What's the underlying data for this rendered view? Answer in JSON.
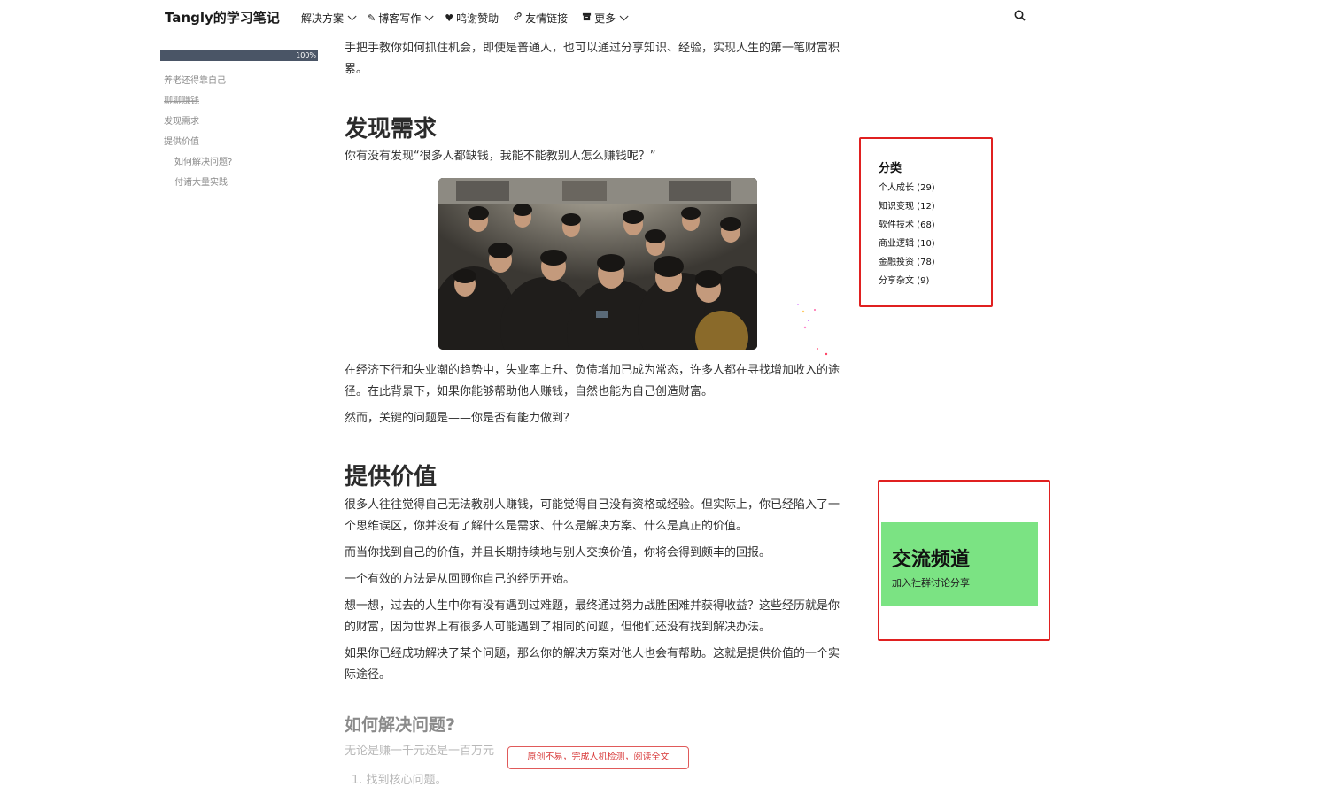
{
  "header": {
    "brand": "Tangly的学习笔记",
    "nav": [
      {
        "label": "解决方案",
        "icon": "",
        "dropdown": true
      },
      {
        "label": "博客写作",
        "icon": "pen-icon",
        "dropdown": true
      },
      {
        "label": "鸣谢赞助",
        "icon": "heart-icon",
        "dropdown": false
      },
      {
        "label": "友情链接",
        "icon": "link-icon",
        "dropdown": false
      },
      {
        "label": "更多",
        "icon": "archive-icon",
        "dropdown": true
      }
    ]
  },
  "toc": {
    "progress": "100%",
    "items": [
      {
        "label": "养老还得靠自己"
      },
      {
        "label": "聊聊赚钱"
      },
      {
        "label": "发现需求"
      },
      {
        "label": "提供价值"
      },
      {
        "label": "如何解决问题?"
      },
      {
        "label": "付诸大量实践"
      }
    ]
  },
  "article": {
    "intro": "手把手教你如何抓住机会，即使是普通人，也可以通过分享知识、经验，实现人生的第一笔财富积累。",
    "h_demand": "发现需求",
    "p_demand_q": "你有没有发现“很多人都缺钱，我能不能教别人怎么赚钱呢？”",
    "p_demand_1": "在经济下行和失业潮的趋势中，失业率上升、负债增加已成为常态，许多人都在寻找增加收入的途径。在此背景下，如果你能够帮助他人赚钱，自然也能为自己创造财富。",
    "p_demand_2": "然而，关键的问题是——你是否有能力做到？",
    "h_value": "提供价值",
    "p_value_1": "很多人往往觉得自己无法教别人赚钱，可能觉得自己没有资格或经验。但实际上，你已经陷入了一个思维误区，你并没有了解什么是需求、什么是解决方案、什么是真正的价值。",
    "p_value_2": "而当你找到自己的价值，并且长期持续地与别人交换价值，你将会得到颇丰的回报。",
    "p_value_3": "一个有效的方法是从回顾你自己的经历开始。",
    "p_value_4": "想一想，过去的人生中你有没有遇到过难题，最终通过努力战胜困难并获得收益？这些经历就是你的财富，因为世界上有很多人可能遇到了相同的问题，但他们还没有找到解决办法。",
    "p_value_5": "如果你已经成功解决了某个问题，那么你的解决方案对他人也会有帮助。这就是提供价值的一个实际途径。",
    "h_solve": "如何解决问题?",
    "p_solve_1": "无论是赚一千元还是一百万元",
    "li_1": "1. 找到核心问题。",
    "cta": "原创不易，完成人机检测，阅读全文"
  },
  "sidebar": {
    "categories": {
      "title": "分类",
      "items": [
        {
          "label": "个人成长 (29)"
        },
        {
          "label": "知识变现 (12)"
        },
        {
          "label": "软件技术 (68)"
        },
        {
          "label": "商业逻辑 (10)"
        },
        {
          "label": "金融投资 (78)"
        },
        {
          "label": "分享杂文 (9)"
        }
      ]
    },
    "channel": {
      "title": "交流频道",
      "subtitle": "加入社群讨论分享",
      "color": "#7be383"
    }
  },
  "colors": {
    "highlight_border": "#e02020",
    "progress_bar": "#4a5566",
    "cta": "#d93d3d"
  }
}
